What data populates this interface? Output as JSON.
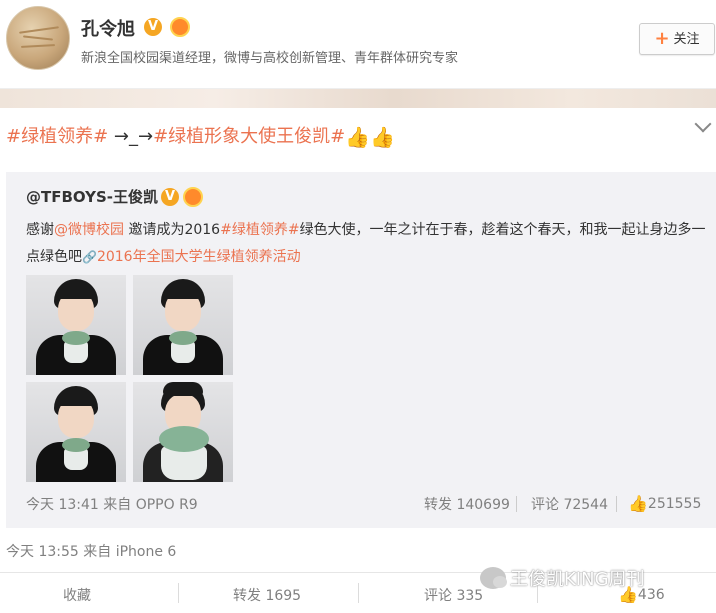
{
  "profile": {
    "name": "孔令旭",
    "verified_mark": "V",
    "bio": "新浪全国校园渠道经理，微博与高校创新管理、青年群体研究专家",
    "follow_label": "关注",
    "follow_icon": "plus-icon"
  },
  "post": {
    "hashtag1": "#绿植领养#",
    "arrow_text": " →_→",
    "hashtag2": "#绿植形象大使王俊凯#",
    "emoji": "👍👍",
    "time": "今天 13:55",
    "source": "来自 iPhone 6"
  },
  "repost": {
    "author": "@TFBOYS-王俊凯",
    "verified_mark": "V",
    "text_pre": "感谢",
    "mention": "@微博校园",
    "text_mid": " 邀请成为2016",
    "hashtag": "#绿植领养#",
    "text_post": "绿色大使，一年之计在于春，趁着这个春天，和我一起让身边多一点绿色吧",
    "link_text": "2016年全国大学生绿植领养活动",
    "time": "今天 13:41",
    "source": "来自 OPPO R9",
    "forward_label": "转发 140699",
    "comment_label": "评论 72544",
    "like_count": "251555"
  },
  "actions": {
    "favorite": "收藏",
    "forward": "转发 1695",
    "comment": "评论 335",
    "like_count": "436"
  },
  "watermark": "王俊凯KING周刊",
  "colors": {
    "accent": "#eb7350",
    "verified": "#f5a623",
    "repost_bg": "#f2f2f5",
    "meta_text": "#808080"
  }
}
